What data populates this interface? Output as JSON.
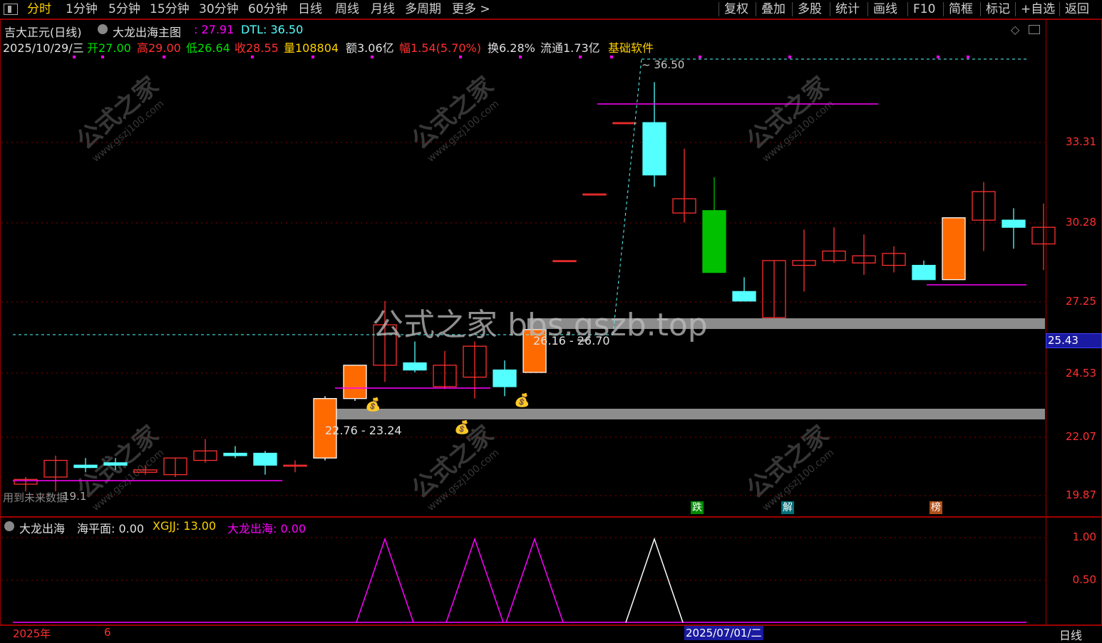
{
  "toolbar": {
    "left": [
      "分时",
      "1分钟",
      "5分钟",
      "15分钟",
      "30分钟",
      "60分钟",
      "日线",
      "周线",
      "月线",
      "多周期",
      "更多 >"
    ],
    "right": [
      "复权",
      "叠加",
      "多股",
      "统计",
      "画线",
      "F10",
      "简框",
      "标记",
      "+自选",
      "返回"
    ],
    "active": "分时"
  },
  "main_header": {
    "stock": "吉大正元(日线)",
    "indicator": "大龙出海主图",
    "ind_value": ": 27.91",
    "dtl": "DTL: 36.50",
    "date": "2025/10/29/三",
    "open": "开27.00",
    "high": "高29.00",
    "low": "低26.64",
    "close": "收28.55",
    "vol": "量108804",
    "amount": "额3.06亿",
    "change": "幅1.54(5.70%)",
    "turnover": "换6.28%",
    "float": "流通1.73亿",
    "tag": "基础软件"
  },
  "annotations": {
    "peak": "36.50",
    "zone_high": "26.16 - 26.70",
    "zone_low": "22.76 - 23.24",
    "bottom_left": "用到未来数据",
    "bottom_num": "19.1"
  },
  "price_axis": [
    "33.31",
    "30.28",
    "27.25",
    "25.43",
    "24.53",
    "22.07",
    "19.87"
  ],
  "price_current": "25.43",
  "event_tags": [
    "跌",
    "解",
    "榜"
  ],
  "overlay_text": "公式之家 bbs.gszb.top",
  "watermark": {
    "cn": "公式之家",
    "url": "www.gszj100.com"
  },
  "sub_header": {
    "name": "大龙出海",
    "sea": "海平面: 0.00",
    "xgjj": "XGJJ: 13.00",
    "dlch": "大龙出海: 0.00"
  },
  "sub_axis": [
    "1.00",
    "0.50"
  ],
  "time_axis": {
    "year": "2025年",
    "month": "6",
    "cursor": "2025/07/01/二",
    "period": "日线"
  },
  "colors": {
    "up": "#ff3030",
    "down": "#54ffff",
    "green": "#00c000",
    "orange": "#ff6a00",
    "magenta": "#ff00ff",
    "grey_band": "#8c8c8c"
  },
  "chart_data": {
    "type": "candlestick",
    "ylim": [
      19.0,
      37.5
    ],
    "candles": [
      {
        "o": 19.6,
        "h": 19.9,
        "l": 19.3,
        "c": 19.8
      },
      {
        "o": 19.9,
        "h": 20.8,
        "l": 19.3,
        "c": 20.6
      },
      {
        "o": 20.4,
        "h": 20.7,
        "l": 20.1,
        "c": 20.3
      },
      {
        "o": 20.5,
        "h": 20.7,
        "l": 20.2,
        "c": 20.4
      },
      {
        "o": 20.1,
        "h": 20.4,
        "l": 20.0,
        "c": 20.2
      },
      {
        "o": 20.0,
        "h": 20.7,
        "l": 19.9,
        "c": 20.7
      },
      {
        "o": 20.6,
        "h": 21.5,
        "l": 20.5,
        "c": 21.0
      },
      {
        "o": 20.9,
        "h": 21.2,
        "l": 20.7,
        "c": 20.8
      },
      {
        "o": 20.9,
        "h": 21.0,
        "l": 20.0,
        "c": 20.4
      },
      {
        "o": 20.4,
        "h": 20.6,
        "l": 20.1,
        "c": 20.4
      },
      {
        "o": 20.7,
        "h": 23.3,
        "l": 20.6,
        "c": 23.2
      },
      {
        "o": 23.2,
        "h": 24.6,
        "l": 23.1,
        "c": 24.6
      },
      {
        "o": 24.6,
        "h": 27.3,
        "l": 23.9,
        "c": 26.3
      },
      {
        "o": 24.7,
        "h": 25.6,
        "l": 24.3,
        "c": 24.4
      },
      {
        "o": 23.7,
        "h": 25.2,
        "l": 23.6,
        "c": 24.6
      },
      {
        "o": 24.1,
        "h": 25.6,
        "l": 23.2,
        "c": 25.4
      },
      {
        "o": 24.4,
        "h": 24.8,
        "l": 23.3,
        "c": 23.7
      },
      {
        "o": 24.3,
        "h": 26.1,
        "l": 24.3,
        "c": 26.1
      },
      {
        "o": 29.0,
        "h": 29.0,
        "l": 29.0,
        "c": 29.0
      },
      {
        "o": 31.8,
        "h": 31.8,
        "l": 31.8,
        "c": 31.8
      },
      {
        "o": 34.8,
        "h": 34.8,
        "l": 34.8,
        "c": 34.8
      },
      {
        "o": 34.8,
        "h": 36.5,
        "l": 32.1,
        "c": 32.6
      },
      {
        "o": 31.0,
        "h": 33.7,
        "l": 30.6,
        "c": 31.6
      },
      {
        "o": 31.1,
        "h": 32.5,
        "l": 28.5,
        "c": 28.5
      },
      {
        "o": 27.7,
        "h": 28.3,
        "l": 27.5,
        "c": 27.3
      },
      {
        "o": 26.6,
        "h": 29.0,
        "l": 26.6,
        "c": 29.0
      },
      {
        "o": 28.8,
        "h": 30.3,
        "l": 27.7,
        "c": 29.0
      },
      {
        "o": 29.0,
        "h": 30.4,
        "l": 28.9,
        "c": 29.4
      },
      {
        "o": 28.9,
        "h": 30.1,
        "l": 28.4,
        "c": 29.2
      },
      {
        "o": 28.8,
        "h": 29.6,
        "l": 28.5,
        "c": 29.3
      },
      {
        "o": 28.8,
        "h": 29.0,
        "l": 28.2,
        "c": 28.2
      },
      {
        "o": 28.2,
        "h": 30.8,
        "l": 28.2,
        "c": 30.8
      },
      {
        "o": 30.7,
        "h": 32.3,
        "l": 29.4,
        "c": 31.9
      },
      {
        "o": 30.7,
        "h": 31.2,
        "l": 29.5,
        "c": 30.4
      },
      {
        "o": 29.7,
        "h": 31.4,
        "l": 28.6,
        "c": 30.4
      }
    ],
    "indicator_peaks": [
      {
        "at": 12,
        "color": "#ff00ff"
      },
      {
        "at": 15,
        "color": "#ff00ff"
      },
      {
        "at": 17,
        "color": "#ff00ff"
      },
      {
        "at": 21,
        "color": "#ffffff"
      }
    ]
  }
}
